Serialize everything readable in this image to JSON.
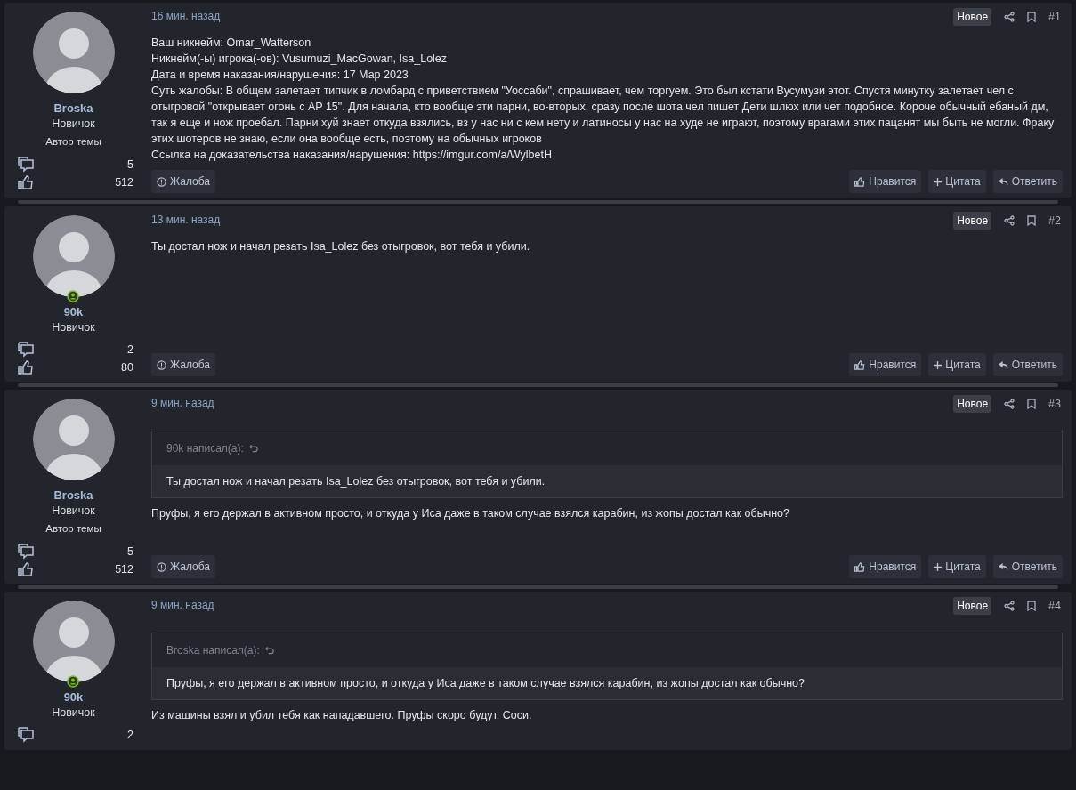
{
  "posts": [
    {
      "author": {
        "name": "Broska",
        "title": "Новичок",
        "badge": "Автор темы",
        "online": false,
        "messages": "5",
        "likes": "512"
      },
      "time": "16 мин. назад",
      "new_label": "Новое",
      "number": "#1",
      "body": [
        "Ваш никнейм: Omar_Watterson",
        "Никнейм(-ы) игрока(-ов): Vusumuzi_MacGowan, Isa_Lolez",
        "Дата и время наказания/нарушения: 17 Мар 2023",
        "Суть жалобы: В общем залетает типчик в ломбард с приветствием \"Уоссаби\", спрашивает, чем торгуем. Это был кстати Вусумузи этот. Спустя минутку залетает чел с отыгровой \"открывает огонь с AP 15\". Для начала, кто вообще эти парни, во-вторых, сразу после шота чел пишет Дети шлюх или чет подобное. Короче обычный ебаный дм, так я еще и нож проебал. Парни хуй знает откуда взялись, вз у нас ни с кем нету и латиносы у нас на худе не играют, поэтому врагами этих пацанят мы быть не могли. Фраку этих шотеров не знаю, если она вообще есть, поэтому на обычных игроков",
        "Ссылка на доказательства наказания/нарушения: https://imgur.com/a/WylbetH"
      ],
      "report": "Жалоба",
      "buttons": [
        {
          "kind": "like",
          "label": "Нравится"
        },
        {
          "kind": "quote",
          "label": "Цитата"
        },
        {
          "kind": "reply",
          "label": "Ответить"
        }
      ]
    },
    {
      "author": {
        "name": "90k",
        "title": "Новичок",
        "online": true,
        "messages": "2",
        "likes": "80"
      },
      "time": "13 мин. назад",
      "new_label": "Новое",
      "number": "#2",
      "body": [
        "Ты достал нож и начал резать Isa_Lolez без отыгровок, вот тебя и убили."
      ],
      "report": "Жалоба",
      "buttons": [
        {
          "kind": "like",
          "label": "Нравится"
        },
        {
          "kind": "quote",
          "label": "Цитата"
        },
        {
          "kind": "reply",
          "label": "Ответить"
        }
      ]
    },
    {
      "author": {
        "name": "Broska",
        "title": "Новичок",
        "badge": "Автор темы",
        "online": false,
        "messages": "5",
        "likes": "512"
      },
      "time": "9 мин. назад",
      "new_label": "Новое",
      "number": "#3",
      "quote": {
        "header": "90k написал(а):",
        "text": "Ты достал нож и начал резать Isa_Lolez без отыгровок, вот тебя и убили."
      },
      "body": [
        "Пруфы, я его держал в активном просто, и откуда у Иса даже в таком случае взялся карабин, из жопы достал как обычно?"
      ],
      "report": "Жалоба",
      "buttons": [
        {
          "kind": "like",
          "label": "Нравится"
        },
        {
          "kind": "quote",
          "label": "Цитата"
        },
        {
          "kind": "reply",
          "label": "Ответить"
        }
      ]
    },
    {
      "author": {
        "name": "90k",
        "title": "Новичок",
        "online": true,
        "messages": "2"
      },
      "time": "9 мин. назад",
      "new_label": "Новое",
      "number": "#4",
      "quote": {
        "header": "Broska написал(а):",
        "text": "Пруфы, я его держал в активном просто, и откуда у Иса даже в таком случае взялся карабин, из жопы достал как обычно?"
      },
      "body": [
        "Из машины взял и убил тебя как нападавшего. Пруфы скоро будут. Соси."
      ]
    }
  ]
}
